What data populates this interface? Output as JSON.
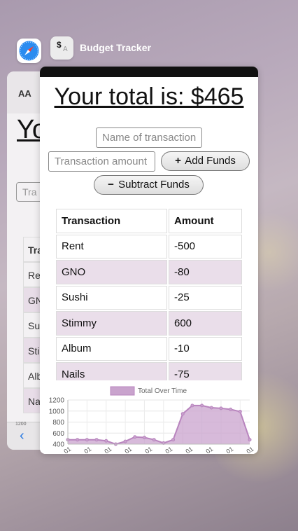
{
  "background_app": {
    "text_size_label": "AA",
    "heading_fragment": "Yo",
    "input_fragment": "Tra",
    "rows": [
      {
        "text": "Tra",
        "alt": false,
        "head": true
      },
      {
        "text": "Re",
        "alt": false,
        "head": false
      },
      {
        "text": "GN",
        "alt": true,
        "head": false
      },
      {
        "text": "Su",
        "alt": false,
        "head": false
      },
      {
        "text": "Sti",
        "alt": true,
        "head": false
      },
      {
        "text": "Alb",
        "alt": false,
        "head": false
      },
      {
        "text": "Na",
        "alt": true,
        "head": false
      }
    ],
    "axis_fragment": "1200",
    "back_chevron": "‹"
  },
  "switcher": {
    "app_name": "Budget Tracker",
    "app_icon_text": "$",
    "app_icon_subtext": "A"
  },
  "app": {
    "total_label": "Your total is: $465",
    "name_placeholder": "Name of transaction",
    "amount_placeholder": "Transaction amount",
    "add_button_symbol": "+",
    "add_button_label": "Add Funds",
    "subtract_button_symbol": "−",
    "subtract_button_label": "Subtract Funds",
    "table": {
      "headers": [
        "Transaction",
        "Amount"
      ],
      "rows": [
        [
          "Rent",
          "-500"
        ],
        [
          "GNO",
          "-80"
        ],
        [
          "Sushi",
          "-25"
        ],
        [
          "Stimmy",
          "600"
        ],
        [
          "Album",
          "-10"
        ],
        [
          "Nails",
          "-75"
        ]
      ]
    }
  },
  "chart_data": {
    "type": "line",
    "legend": "Total Over Time",
    "legend_placement": "top-center",
    "fill": true,
    "color": "#c9a3cd",
    "line_color": "#b884be",
    "y_ticks": [
      1200,
      1000,
      800,
      600,
      400
    ],
    "ylim": [
      400,
      1200
    ],
    "grid": true,
    "x_tick_fragment": "01",
    "values": [
      480,
      480,
      480,
      480,
      460,
      400,
      450,
      530,
      520,
      480,
      420,
      480,
      950,
      1100,
      1100,
      1060,
      1050,
      1030,
      990,
      480
    ]
  }
}
